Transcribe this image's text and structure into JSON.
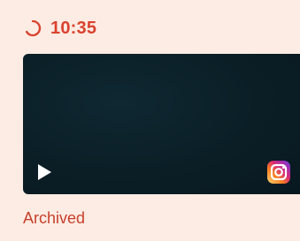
{
  "card": {
    "time": "10:35",
    "status": "Archived"
  },
  "icons": {
    "status": "loading-circle-icon",
    "play": "play-icon",
    "platform": "instagram-icon"
  },
  "colors": {
    "accent": "#d9432e",
    "background": "#fdece4",
    "video_background": "#0b1e26"
  }
}
